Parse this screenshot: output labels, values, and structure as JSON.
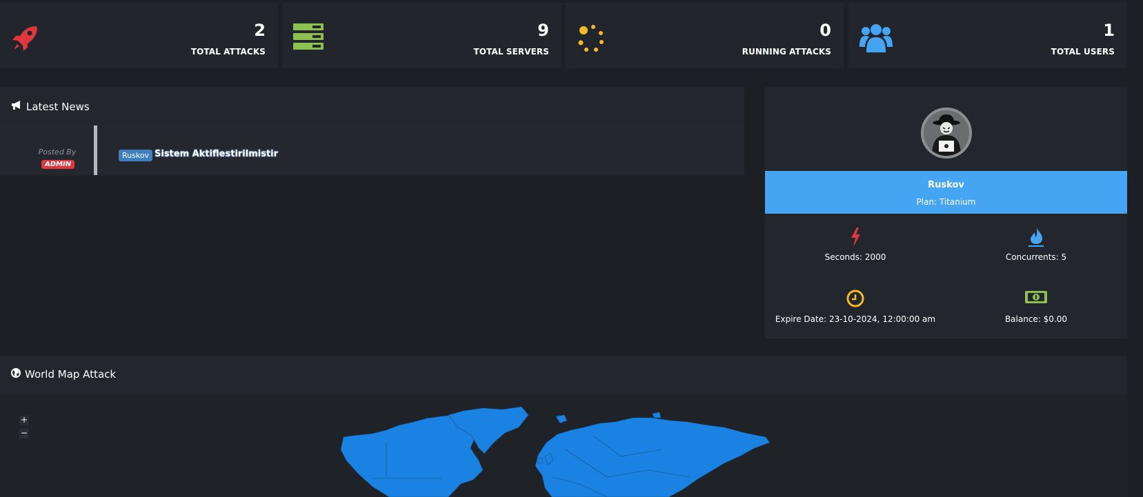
{
  "stats": [
    {
      "value": "2",
      "label": "TOTAL ATTACKS",
      "icon": "rocket-icon",
      "color": "#e0373e"
    },
    {
      "value": "9",
      "label": "TOTAL SERVERS",
      "icon": "server-icon",
      "color": "#8cc152"
    },
    {
      "value": "0",
      "label": "RUNNING ATTACKS",
      "icon": "spinner-icon",
      "color": "#f6bb1f"
    },
    {
      "value": "1",
      "label": "TOTAL USERS",
      "icon": "users-icon",
      "color": "#45a5f3"
    }
  ],
  "news": {
    "title": "Latest News",
    "posted_by": "Posted By",
    "role": "ADMIN",
    "author": "Ruskov",
    "text": "Sistem Aktiflestirilmistir"
  },
  "profile": {
    "name": "Ruskov",
    "plan": "Plan: Titanium",
    "seconds": "Seconds: 2000",
    "concurrents": "Concurrents: 5",
    "expire": "Expire Date: 23-10-2024, 12:00:00 am",
    "balance": "Balance: $0.00",
    "accent": "#45a5f3"
  },
  "map": {
    "title": "World Map Attack",
    "zoom_in": "+",
    "zoom_out": "−",
    "land_color": "#1a82e2"
  }
}
